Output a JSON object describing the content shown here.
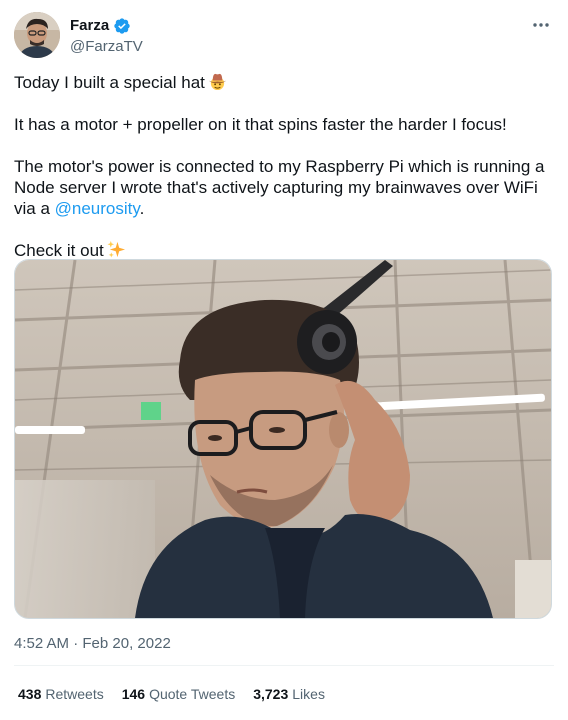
{
  "author": {
    "display_name": "Farza",
    "handle": "@FarzaTV",
    "verified": true,
    "avatar_icon": "profile-photo",
    "badge_icon": "verified-badge-icon",
    "more_icon": "more-options-icon"
  },
  "tweet": {
    "line1": "Today I built a special hat",
    "line1_emoji": "cowboy-hat-face",
    "line2": "It has a motor + propeller on it that spins faster the harder I focus!",
    "line3_text": "The motor's power is connected to my Raspberry Pi which is running a Node server I wrote that's actively capturing my brainwaves over WiFi via a ",
    "line3_mention": "@neurosity",
    "line3_end": ".",
    "line4": "Check it out",
    "line4_emoji": "sparkles"
  },
  "media": {
    "type": "video-thumbnail",
    "description_icon": "video-frame"
  },
  "meta": {
    "time": "4:52 AM",
    "separator": "·",
    "date": "Feb 20, 2022"
  },
  "stats": {
    "retweets_count": "438",
    "retweets_label": "Retweets",
    "quotes_count": "146",
    "quotes_label": "Quote Tweets",
    "likes_count": "3,723",
    "likes_label": "Likes"
  },
  "colors": {
    "accent": "#1d9bf0",
    "text": "#0f1419",
    "secondary": "#536471",
    "border": "#eff3f4"
  }
}
